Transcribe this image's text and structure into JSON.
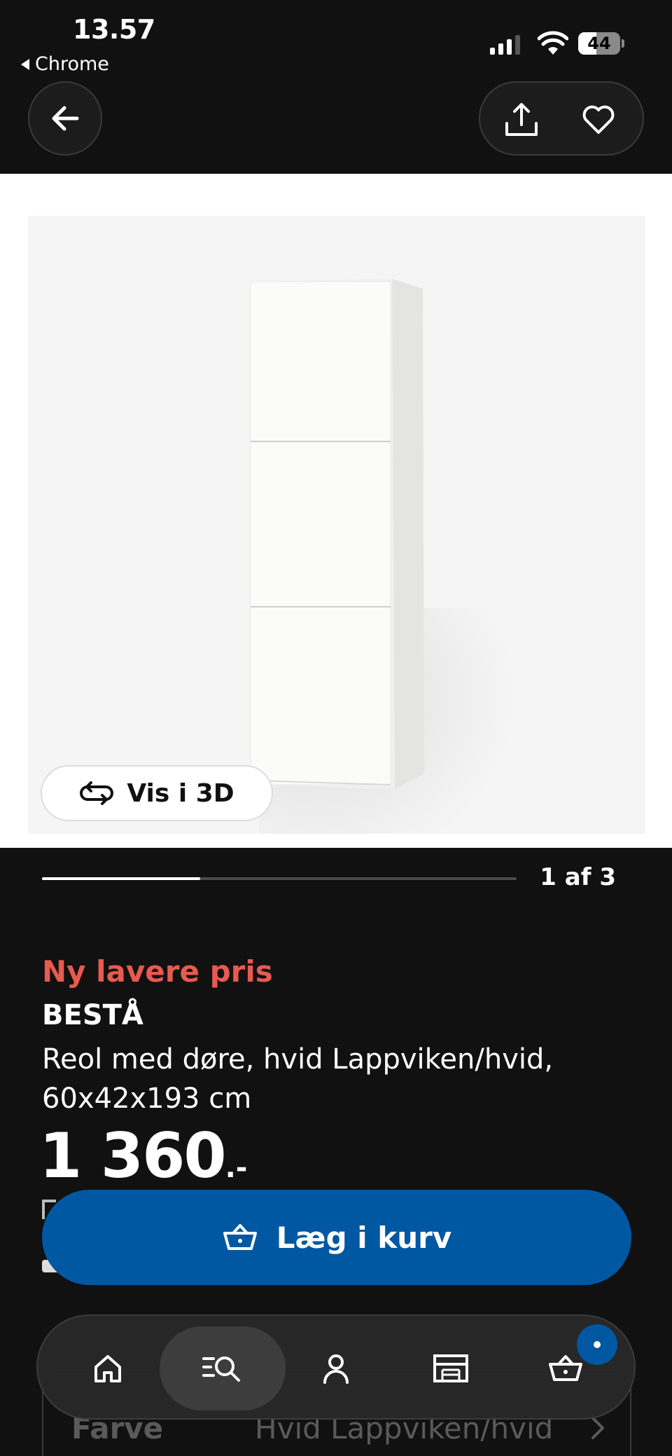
{
  "status_bar": {
    "time": "13.57",
    "back_app": "Chrome",
    "battery_level": "44",
    "battery_fraction": 0.44,
    "signal_bars_filled": 3,
    "signal_bars_total": 4
  },
  "nav": {
    "back_icon": "arrow-left-icon",
    "share_icon": "share-icon",
    "favorite_icon": "heart-icon"
  },
  "gallery": {
    "view_3d_label": "Vis i 3D",
    "view_3d_icon": "rotate-icon",
    "page_indicator": "1 af 3",
    "current_page": 1,
    "total_pages": 3
  },
  "product": {
    "promo": "Ny lavere pris",
    "name": "BESTÅ",
    "description": "Reol med døre, hvid Lappviken/hvid, 60x42x193 cm",
    "price_main": "1 360",
    "price_suffix": ".-"
  },
  "cart_button": {
    "label": "Læg i kurv",
    "icon": "basket-icon"
  },
  "farve": {
    "label": "Farve",
    "value": "Hvid Lappviken/hvid"
  },
  "tabbar": {
    "items": [
      {
        "name": "home",
        "icon": "home-icon"
      },
      {
        "name": "search",
        "icon": "search-icon",
        "active": true
      },
      {
        "name": "profile",
        "icon": "person-icon"
      },
      {
        "name": "store",
        "icon": "store-icon"
      },
      {
        "name": "cart",
        "icon": "basket-icon"
      }
    ]
  },
  "colors": {
    "background": "#111111",
    "accent_blue": "#0058a3",
    "promo_red": "#e85a4f"
  }
}
